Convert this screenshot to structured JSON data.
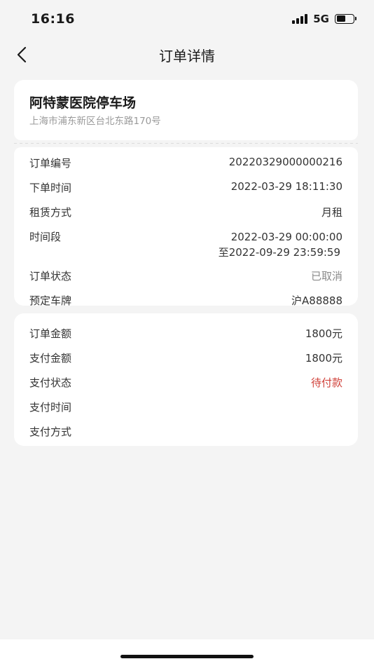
{
  "status_bar": {
    "time": "16:16",
    "network": "5G",
    "battery_level": 0.55,
    "signal_bars": 4
  },
  "nav": {
    "title": "订单详情",
    "back_icon": "chevron-left-icon"
  },
  "parking": {
    "name": "阿特蒙医院停车场",
    "address": "上海市浦东新区台北东路170号"
  },
  "order": {
    "number_label": "订单编号",
    "number_value": "20220329000000216",
    "time_label": "下单时间",
    "time_value": "2022-03-29 18:11:30",
    "rent_label": "租赁方式",
    "rent_value": "月租",
    "period_label": "时间段",
    "period_start": "2022-03-29 00:00:00",
    "period_end": "至2022-09-29 23:59:59",
    "status_label": "订单状态",
    "status_value": "已取消",
    "plate_label": "预定车牌",
    "plate_value": "沪A88888"
  },
  "payment": {
    "amount_label": "订单金额",
    "amount_value": "1800元",
    "paid_label": "支付金额",
    "paid_value": "1800元",
    "status_label": "支付状态",
    "status_value": "待付款",
    "time_label": "支付时间",
    "time_value": "",
    "method_label": "支付方式",
    "method_value": ""
  },
  "colors": {
    "background": "#f4f4f4",
    "card": "#ffffff",
    "warning": "#d0413a",
    "muted": "#8a8a8a"
  }
}
